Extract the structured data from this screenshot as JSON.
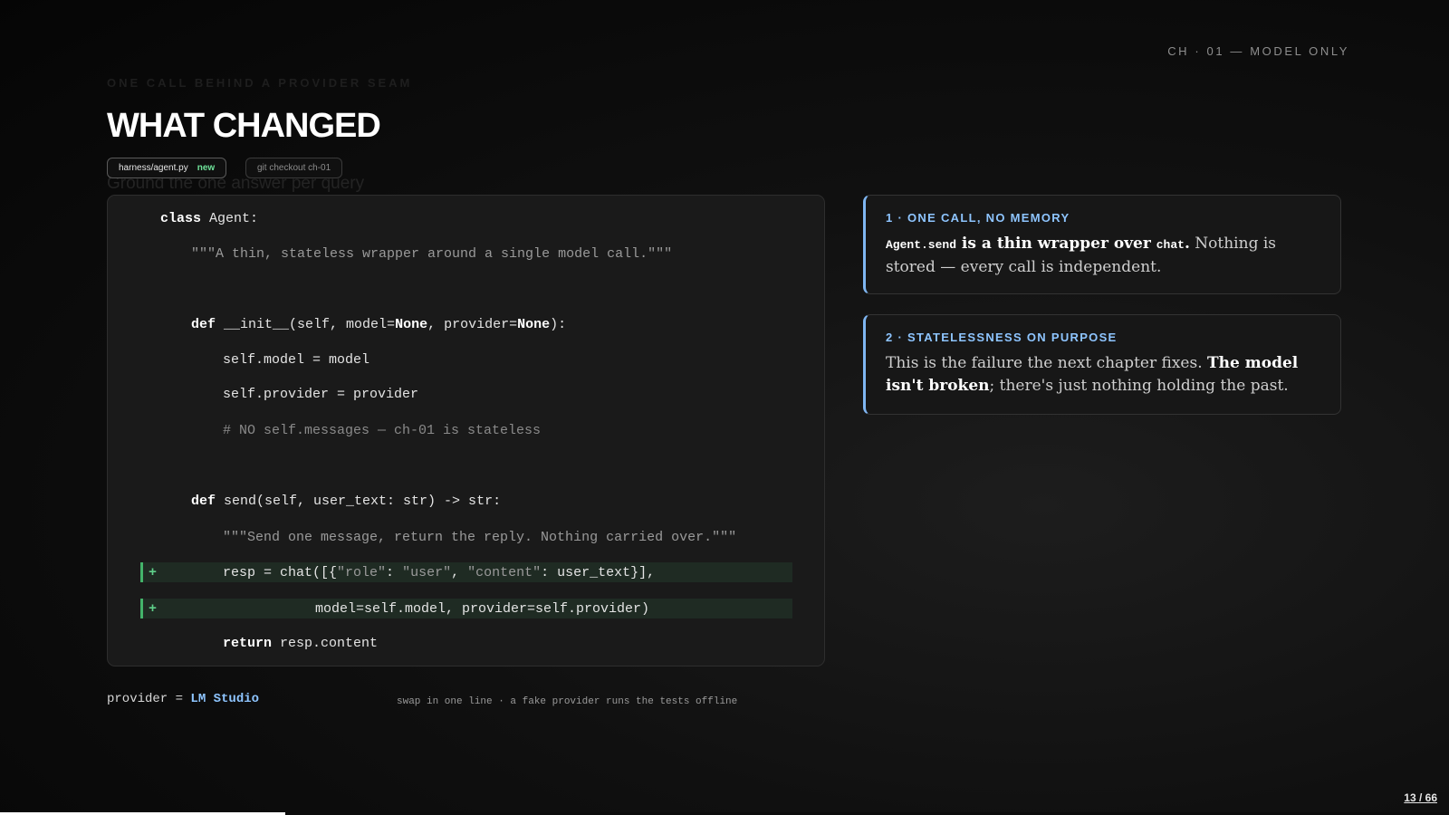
{
  "header": {
    "chapter_label": "CH · 01 — MODEL ONLY",
    "kicker_faded": "ONE CALL BEHIND A PROVIDER SEAM",
    "title": "WHAT CHANGED",
    "subtitle_faded": "Ground the one answer per query"
  },
  "chips": {
    "file": "harness/agent.py",
    "file_badge": "new",
    "command": "git checkout ch-01"
  },
  "code": {
    "lines": [
      {
        "kw": "class",
        "rest": " Agent:"
      },
      {
        "str": "\"\"\"A thin, stateless wrapper around a single model call.\"\"\""
      },
      {
        "kw": "def",
        "a": " __init__(self, model=",
        "none1": "None",
        "b": ", provider=",
        "none2": "None",
        "c": "):"
      },
      {
        "text": "self.model = model"
      },
      {
        "text": "self.provider = provider"
      },
      {
        "comment": "# NO self.messages — ch-01 is stateless"
      },
      {
        "kw": "def",
        "rest": " send(self, user_text: str) -> str:"
      },
      {
        "str": "\"\"\"Send one message, return the reply. Nothing carried over.\"\"\""
      },
      {
        "marker": "+",
        "a": "resp = chat([{",
        "s1": "\"role\"",
        "b": ": ",
        "s2": "\"user\"",
        "c": ", ",
        "s3": "\"content\"",
        "d": ": user_text}],"
      },
      {
        "marker": "+",
        "text": "model=self.model, provider=self.provider)"
      },
      {
        "kw": "return",
        "rest": " resp.content"
      }
    ]
  },
  "footer": {
    "provider_label": "provider = ",
    "provider_value": "LM Studio",
    "note": "swap in one line · a fake provider runs the tests offline"
  },
  "cards": [
    {
      "title": "1 · ONE CALL, NO MEMORY",
      "code_a": "Agent.send",
      "bold_a": " is a thin wrapper over ",
      "code_b": "chat",
      "bold_b": ".",
      "rest": " Nothing is stored — every call is independent."
    },
    {
      "title": "2 · STATELESSNESS ON PURPOSE",
      "text_a": "This is the failure the next chapter fixes. ",
      "bold": "The model isn't broken",
      "text_b": "; there's just nothing holding the past."
    }
  ],
  "pagination": {
    "label": "13 / 66",
    "current": 13,
    "total": 66
  },
  "colors": {
    "accent": "#8ec5ff",
    "diff_add": "#43b36a",
    "new_badge": "#6fe39a"
  }
}
